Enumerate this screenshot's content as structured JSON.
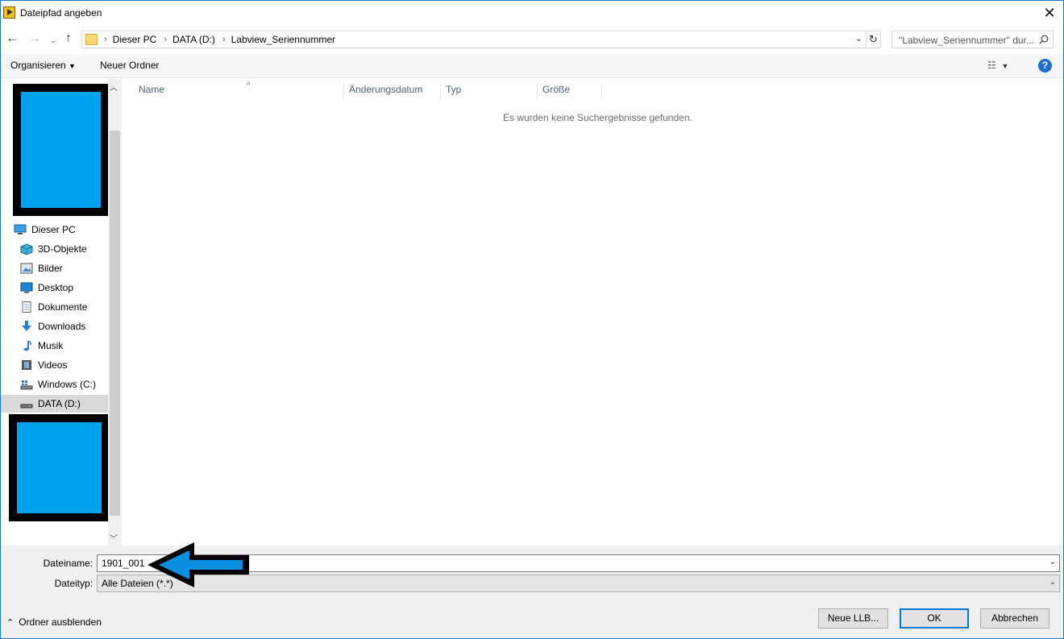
{
  "window": {
    "title": "Dateipfad angeben",
    "close_glyph": "✕"
  },
  "address": {
    "crumbs": [
      "Dieser PC",
      "DATA (D:)",
      "Labview_Seriennummer"
    ],
    "search_placeholder": "\"Labview_Seriennummer\" dur..."
  },
  "toolbar": {
    "organize": "Organisieren",
    "new_folder": "Neuer Ordner"
  },
  "nav": {
    "items": [
      {
        "label": "Dieser PC",
        "icon": "computer-icon"
      },
      {
        "label": "3D-Objekte",
        "icon": "cube-icon"
      },
      {
        "label": "Bilder",
        "icon": "pictures-icon"
      },
      {
        "label": "Desktop",
        "icon": "desktop-icon"
      },
      {
        "label": "Dokumente",
        "icon": "document-icon"
      },
      {
        "label": "Downloads",
        "icon": "download-icon"
      },
      {
        "label": "Musik",
        "icon": "music-icon"
      },
      {
        "label": "Videos",
        "icon": "video-icon"
      },
      {
        "label": "Windows (C:)",
        "icon": "drive-icon"
      },
      {
        "label": "DATA (D:)",
        "icon": "drive-icon",
        "selected": true
      }
    ]
  },
  "list": {
    "columns": [
      "Name",
      "Änderungsdatum",
      "Typ",
      "Größe"
    ],
    "empty_message": "Es wurden keine Suchergebnisse gefunden."
  },
  "form": {
    "filename_label": "Dateiname:",
    "filename_value": "1901_001",
    "filetype_label": "Dateityp:",
    "filetype_value": "Alle Dateien (*.*)"
  },
  "footer": {
    "hide_folders": "Ordner ausblenden",
    "buttons": {
      "new_llb": "Neue LLB...",
      "ok": "OK",
      "cancel": "Abbrechen"
    }
  },
  "colors": {
    "redaction": "#00a2ed",
    "accent": "#0078d7"
  }
}
